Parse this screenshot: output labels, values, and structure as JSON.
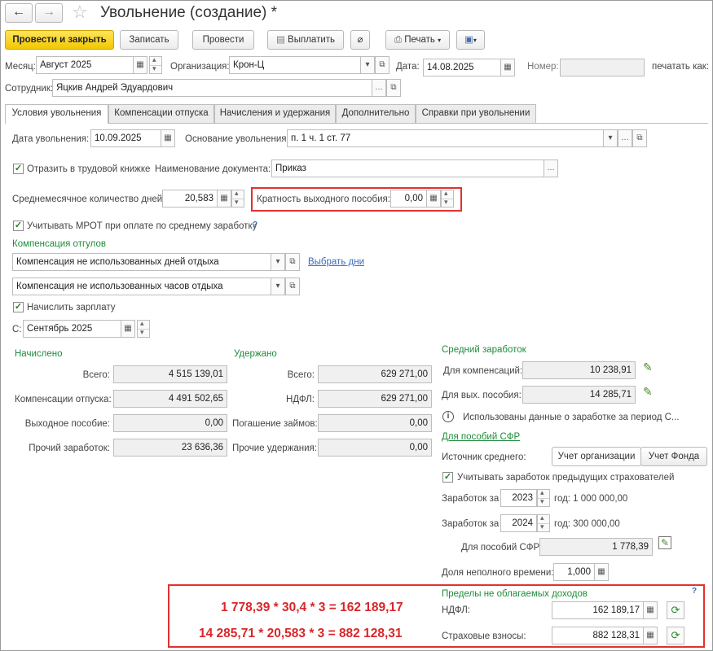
{
  "title": "Увольнение (создание) *",
  "toolbar": {
    "post_close": "Провести и закрыть",
    "save": "Записать",
    "post": "Провести",
    "pay": "Выплатить",
    "print": "Печать"
  },
  "header": {
    "month_label": "Месяц:",
    "month_value": "Август 2025",
    "org_label": "Организация:",
    "org_value": "Крон-Ц",
    "date_label": "Дата:",
    "date_value": "14.08.2025",
    "number_label": "Номер:",
    "number_value": "",
    "print_as_label": "печатать как:",
    "employee_label": "Сотрудник:",
    "employee_value": "Яцкив Андрей Эдуардович"
  },
  "tabs": [
    "Условия увольнения",
    "Компенсации отпуска",
    "Начисления и удержания",
    "Дополнительно",
    "Справки при увольнении"
  ],
  "dismissal": {
    "date_label": "Дата увольнения:",
    "date_value": "10.09.2025",
    "basis_label": "Основание увольнения:",
    "basis_value": "п. 1 ч. 1 ст. 77",
    "workbook_label": "Отразить в трудовой книжке",
    "doc_name_label": "Наименование документа:",
    "doc_name_value": "Приказ",
    "avg_days_label": "Среднемесячное количество дней:",
    "avg_days_value": "20,583",
    "multiplicity_label": "Кратность выходного пособия:",
    "multiplicity_value": "0,00",
    "mrot_label": "Учитывать МРОТ при оплате по среднему заработку",
    "mrot_help": "?"
  },
  "compensation": {
    "title": "Компенсация отгулов",
    "days_value": "Компенсация не использованных дней отдыха",
    "choose_days": "Выбрать дни",
    "hours_value": "Компенсация не использованных часов отдыха",
    "accrue_salary": "Начислить зарплату",
    "from_label": "С:",
    "from_value": "Сентябрь 2025"
  },
  "accrued": {
    "title": "Начислено",
    "rows": [
      {
        "label": "Всего:",
        "value": "4 515 139,01"
      },
      {
        "label": "Компенсации отпуска:",
        "value": "4 491 502,65"
      },
      {
        "label": "Выходное пособие:",
        "value": "0,00"
      },
      {
        "label": "Прочий заработок:",
        "value": "23 636,36"
      }
    ]
  },
  "withheld": {
    "title": "Удержано",
    "rows": [
      {
        "label": "Всего:",
        "value": "629 271,00"
      },
      {
        "label": "НДФЛ:",
        "value": "629 271,00"
      },
      {
        "label": "Погашение займов:",
        "value": "0,00"
      },
      {
        "label": "Прочие удержания:",
        "value": "0,00"
      }
    ]
  },
  "avg_earnings": {
    "title": "Средний заработок",
    "for_comp_label": "Для компенсаций:",
    "for_comp_value": "10 238,91",
    "for_severance_label": "Для вых. пособия:",
    "for_severance_value": "14 285,71",
    "info_text": "Использованы данные о заработке за период С...",
    "sfr_link": "Для пособий СФР",
    "source_label": "Источник среднего:",
    "source_org": "Учет организации",
    "source_fund": "Учет Фонда",
    "prev_insurers": "Учитывать заработок предыдущих страхователей",
    "earn_for_label": "Заработок за",
    "year1": "2023",
    "year1_text": "год: 1 000 000,00",
    "year2": "2024",
    "year2_text": "год: 300 000,00",
    "sfr_label": "Для пособий СФР:",
    "sfr_value": "1 778,39",
    "parttime_label": "Доля неполного времени:",
    "parttime_value": "1,000"
  },
  "limits": {
    "title": "Пределы не облагаемых доходов",
    "help": "?",
    "ndfl_label": "НДФЛ:",
    "ndfl_value": "162 189,17",
    "insurance_label": "Страховые взносы:",
    "insurance_value": "882 128,31"
  },
  "annotations": {
    "formula1": "1 778,39 * 30,4 * 3 = 162 189,17",
    "formula2": "14 285,71 * 20,583 * 3 =  882 128,31"
  },
  "colors": {
    "accent_green": "#1f8c3b",
    "highlight_red": "#e23030",
    "primary_button": "#f2c700",
    "link_blue": "#3a6bb8"
  }
}
